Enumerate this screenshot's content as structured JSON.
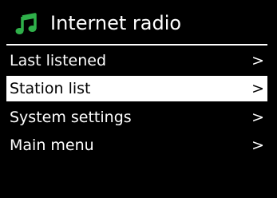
{
  "header": {
    "icon": "music-note-icon",
    "title": "Internet radio",
    "accent_color": "#2fb04a"
  },
  "menu": {
    "selected_index": 1,
    "items": [
      {
        "label": "Last listened",
        "chevron": ">"
      },
      {
        "label": "Station list",
        "chevron": ">"
      },
      {
        "label": "System settings",
        "chevron": ">"
      },
      {
        "label": "Main menu",
        "chevron": ">"
      }
    ]
  }
}
